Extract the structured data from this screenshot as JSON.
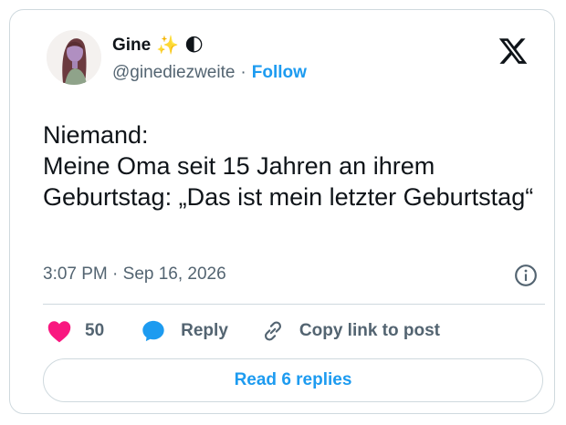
{
  "author": {
    "display_name": "Gine",
    "name_emojis": [
      "✨",
      "🌓"
    ],
    "handle": "@ginediezweite",
    "separator": "·",
    "follow_label": "Follow"
  },
  "tweet": {
    "text": "Niemand:\nMeine Oma seit 15 Jahren an ihrem Geburtstag: „Das ist mein letzter Geburtstag“",
    "timestamp": "3:07 PM · Sep 16, 2026"
  },
  "actions": {
    "like_count": "50",
    "reply_label": "Reply",
    "copy_link_label": "Copy link to post"
  },
  "read_replies_label": "Read 6 replies",
  "icons": {
    "logo": "x-logo-icon",
    "info": "info-icon",
    "like": "heart-icon",
    "reply": "speech-bubble-icon",
    "copy": "link-icon"
  },
  "colors": {
    "accent": "#1d9bf0",
    "like": "#f91880",
    "text": "#0f1419",
    "muted": "#536471",
    "border": "#cfd9de"
  }
}
